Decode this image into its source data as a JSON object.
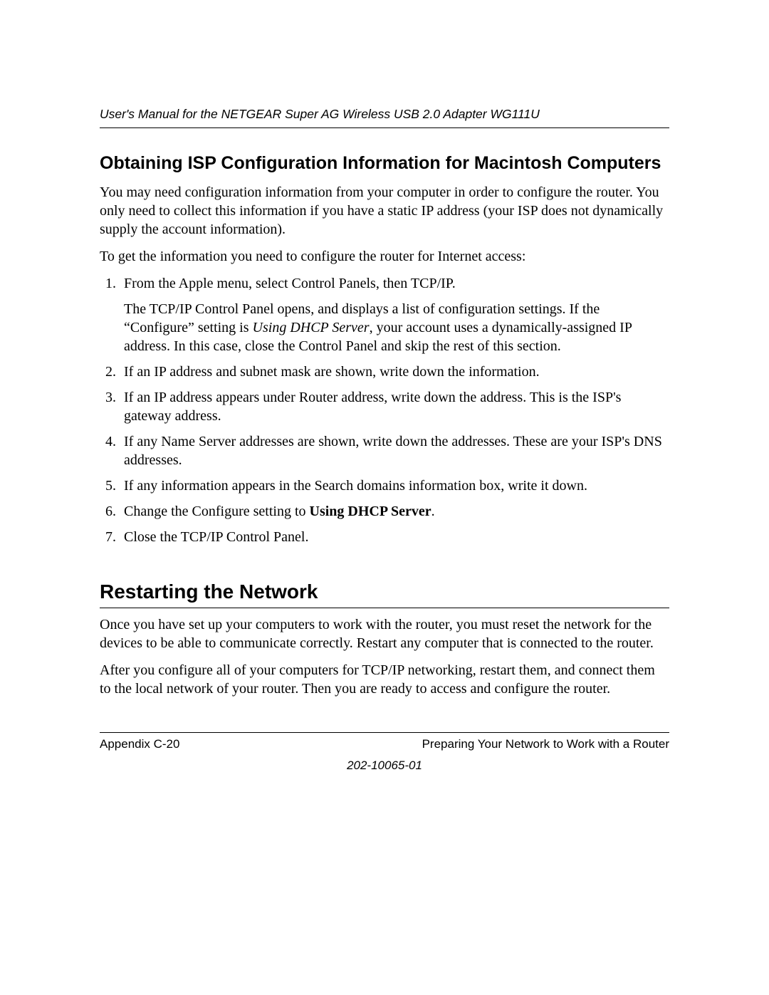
{
  "header": {
    "running_title": "User's Manual for the NETGEAR Super AG Wireless USB 2.0 Adapter WG111U"
  },
  "section1": {
    "heading": "Obtaining ISP Configuration Information for Macintosh Computers",
    "intro": "You may need configuration information from your computer in order to configure the router. You only need to collect this information if you have a static IP address (your ISP does not dynamically supply the account information).",
    "lead": "To get the information you need to configure the router for Internet access:",
    "steps": {
      "s1": "From the Apple menu, select Control Panels, then TCP/IP.",
      "s1_sub_a": "The TCP/IP Control Panel opens, and displays a list of configuration settings. If the “Configure” setting is ",
      "s1_sub_em": "Using DHCP Server",
      "s1_sub_b": ", your account uses a dynamically-assigned IP address. In this case, close the Control Panel and skip the rest of this section.",
      "s2": "If an IP address and subnet mask are shown, write down the information.",
      "s3": "If an IP address appears under Router address, write down the address. This is the ISP's gateway address.",
      "s4": "If any Name Server addresses are shown, write down the addresses. These are your ISP's DNS addresses.",
      "s5": "If any information appears in the Search domains information box, write it down.",
      "s6_a": "Change the Configure setting to ",
      "s6_bold": "Using DHCP Server",
      "s6_b": ".",
      "s7": "Close the TCP/IP Control Panel."
    }
  },
  "section2": {
    "heading": "Restarting the Network",
    "p1": "Once you have set up your computers to work with the router, you must reset the network for the devices to be able to communicate correctly. Restart any computer that is connected to the router.",
    "p2": "After you configure all of your computers for TCP/IP networking, restart them, and connect them to the local network of your router. Then you are ready to access and configure the router."
  },
  "footer": {
    "left": "Appendix C-20",
    "right": "Preparing Your Network to Work with a Router",
    "docnum": "202-10065-01"
  }
}
